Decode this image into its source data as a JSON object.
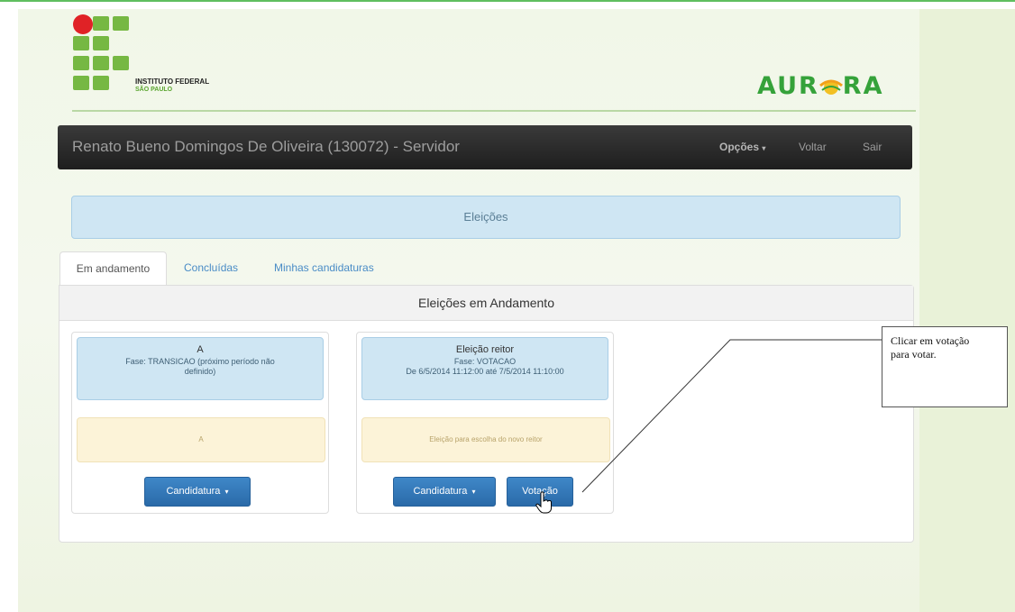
{
  "header": {
    "logo_line1": "INSTITUTO FEDERAL",
    "logo_line2": "SÃO PAULO",
    "app_name_left": "AUR",
    "app_name_right": "RA"
  },
  "navbar": {
    "user_label": "Renato Bueno Domingos De Oliveira (130072) - Servidor",
    "options_label": "Opções",
    "back_label": "Voltar",
    "exit_label": "Sair"
  },
  "page_title": "Eleições",
  "tabs": [
    {
      "label": "Em andamento",
      "active": true
    },
    {
      "label": "Concluídas",
      "active": false
    },
    {
      "label": "Minhas candidaturas",
      "active": false
    }
  ],
  "panel_title": "Eleições em Andamento",
  "elections": [
    {
      "title": "A",
      "phase": "Fase: TRANSICAO (próximo período não",
      "phase_cont": "definido)",
      "period": "",
      "description": "A",
      "candidatura_label": "Candidatura",
      "votacao_label": ""
    },
    {
      "title": "Eleição reitor",
      "phase": "Fase: VOTACAO",
      "phase_cont": "",
      "period": "De 6/5/2014 11:12:00 até 7/5/2014 11:10:00",
      "description": "Eleição para escolha do novo reitor",
      "candidatura_label": "Candidatura",
      "votacao_label": "Votação"
    }
  ],
  "annotation": {
    "text_line1": "Clicar em votação",
    "text_line2": "para votar."
  },
  "colors": {
    "navbar": "#222222",
    "info_panel": "#cfe6f3",
    "description_panel": "#fcf3d8",
    "primary_button": "#2f76b8",
    "brand_green": "#76b843",
    "logo_red": "#e02226"
  }
}
